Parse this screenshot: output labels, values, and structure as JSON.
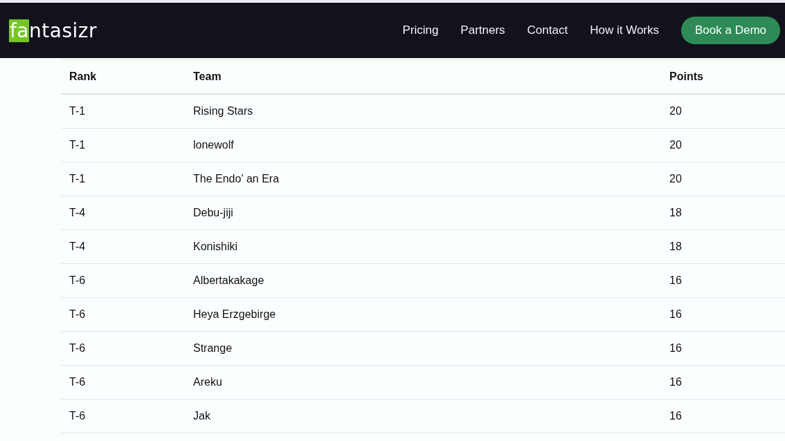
{
  "logo": {
    "highlight": "fa",
    "rest": "ntasizr"
  },
  "nav": {
    "links": [
      "Pricing",
      "Partners",
      "Contact",
      "How it Works"
    ],
    "cta": "Book a Demo"
  },
  "table": {
    "columns": [
      "Rank",
      "Team",
      "Points"
    ],
    "rows": [
      [
        "T-1",
        "Rising Stars",
        "20"
      ],
      [
        "T-1",
        "lonewolf",
        "20"
      ],
      [
        "T-1",
        "The Endo' an Era",
        "20"
      ],
      [
        "T-4",
        "Debu-jiji",
        "18"
      ],
      [
        "T-4",
        "Konishiki",
        "18"
      ],
      [
        "T-6",
        "Albertakakage",
        "16"
      ],
      [
        "T-6",
        "Heya Erzgebirge",
        "16"
      ],
      [
        "T-6",
        "Strange",
        "16"
      ],
      [
        "T-6",
        "Areku",
        "16"
      ],
      [
        "T-6",
        "Jak",
        "16"
      ]
    ]
  }
}
